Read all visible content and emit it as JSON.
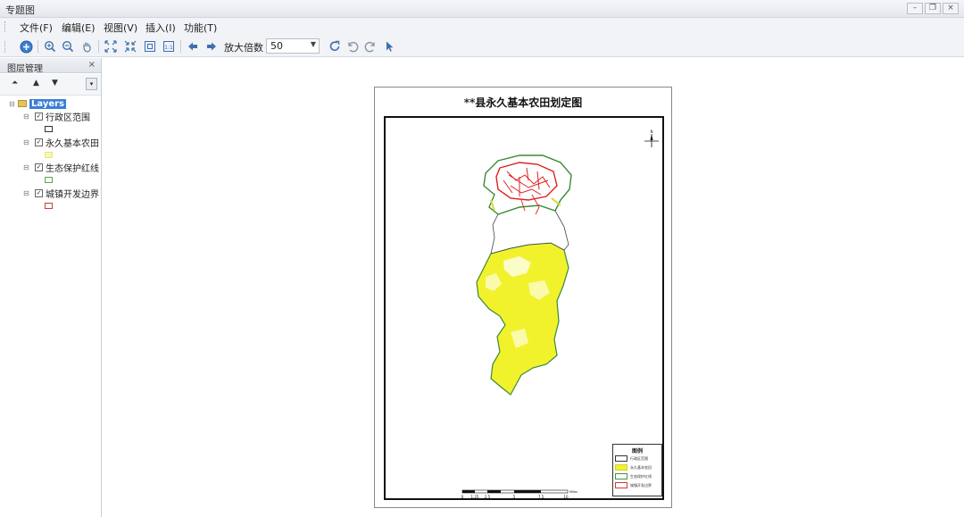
{
  "window": {
    "title": "专题图"
  },
  "menu": {
    "items": [
      "文件(F)",
      "编辑(E)",
      "视图(V)",
      "插入(I)",
      "功能(T)"
    ]
  },
  "toolbar": {
    "zoom_label": "放大倍数",
    "zoom_value": "50"
  },
  "side_panel": {
    "title": "图层管理",
    "root": "Layers",
    "layers": [
      {
        "name": "行政区范围",
        "checked": true,
        "color": "#333333"
      },
      {
        "name": "永久基本农田",
        "checked": true,
        "color": "#e8e870"
      },
      {
        "name": "生态保护红线",
        "checked": true,
        "color": "#5aa84a"
      },
      {
        "name": "城镇开发边界",
        "checked": true,
        "color": "#d23a3a"
      }
    ]
  },
  "map": {
    "title": "**县永久基本农田划定图",
    "legend_title": "图例",
    "legend_items": [
      "行政区范围",
      "永久基本农田",
      "生态保护红线",
      "城镇开发边界"
    ],
    "scale_labels": [
      "0",
      "1.25",
      "2.5",
      "5",
      "7.5",
      "10"
    ],
    "scale_unit": "Miles",
    "north": "N"
  }
}
